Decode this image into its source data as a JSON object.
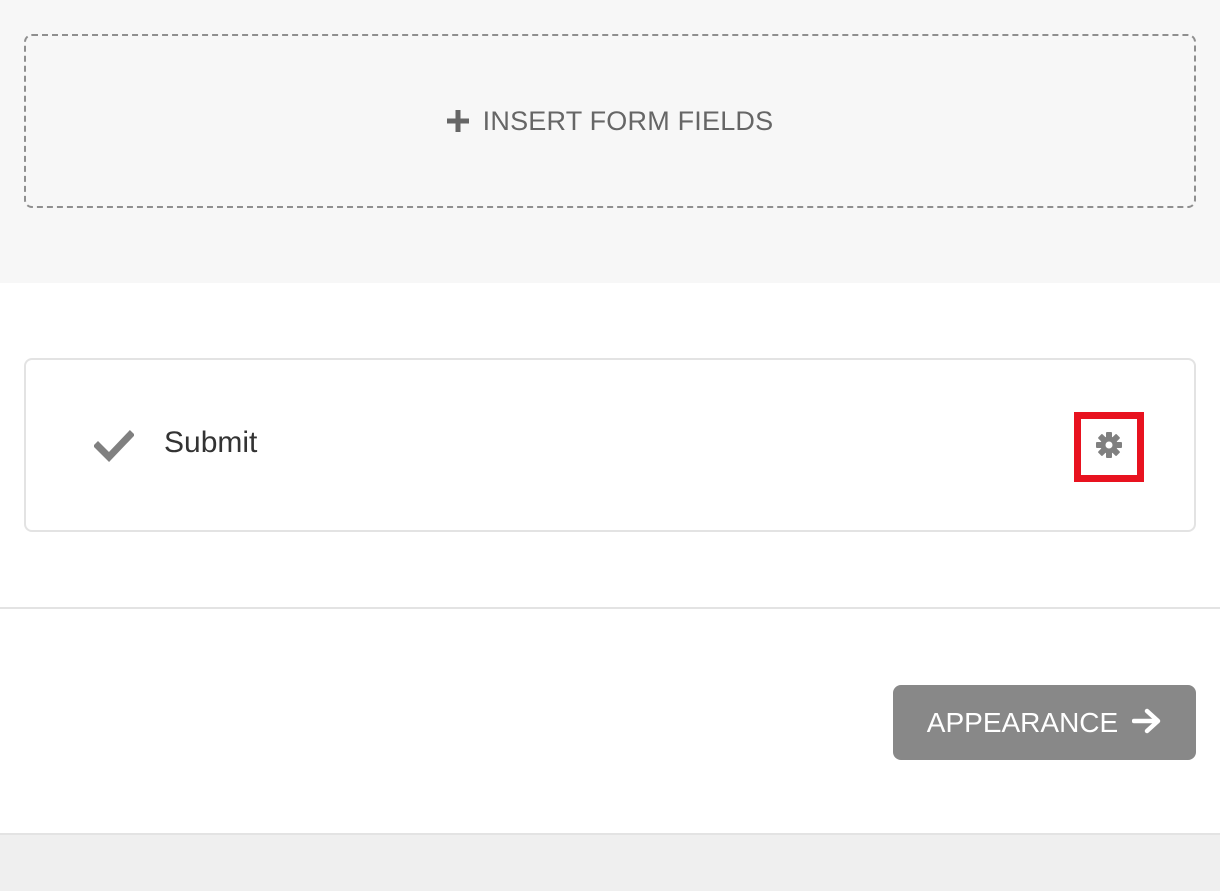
{
  "insert_fields": {
    "label": "INSERT FORM FIELDS",
    "icon": "plus-icon"
  },
  "submit_field": {
    "label": "Submit",
    "check_icon": "check-icon",
    "settings_icon": "gear-icon",
    "highlight_color": "#e8121f"
  },
  "appearance_button": {
    "label": "APPEARANCE",
    "icon": "arrow-right-icon",
    "color": "#888888"
  }
}
